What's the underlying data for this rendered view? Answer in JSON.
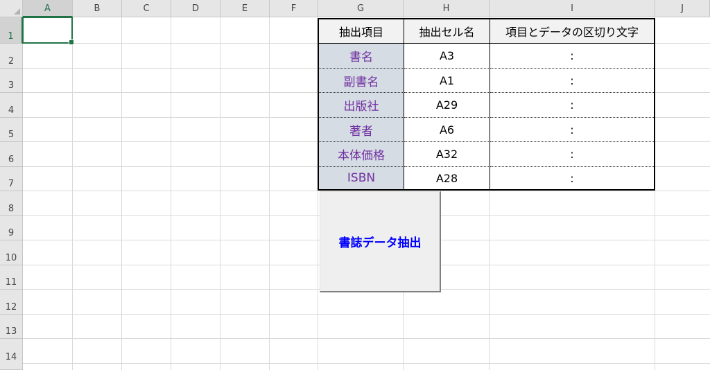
{
  "sheet": {
    "columns": [
      "A",
      "B",
      "C",
      "D",
      "E",
      "F",
      "G",
      "H",
      "I",
      "J"
    ],
    "rows": [
      "1",
      "2",
      "3",
      "4",
      "5",
      "6",
      "7",
      "8",
      "9",
      "10",
      "11",
      "12",
      "13",
      "14"
    ],
    "selected_cell": "A1"
  },
  "table": {
    "headers": [
      "抽出項目",
      "抽出セル名",
      "項目とデータの区切り文字"
    ],
    "rows": [
      {
        "item": "書名",
        "cell": "A3",
        "sep": ":"
      },
      {
        "item": "副書名",
        "cell": "A1",
        "sep": ":"
      },
      {
        "item": "出版社",
        "cell": "A29",
        "sep": ":"
      },
      {
        "item": "著者",
        "cell": "A6",
        "sep": ":"
      },
      {
        "item": "本体価格",
        "cell": "A32",
        "sep": ":"
      },
      {
        "item": "ISBN",
        "cell": "A28",
        "sep": ":"
      }
    ]
  },
  "button": {
    "label": "書誌データ抽出"
  },
  "colors": {
    "accent": "#217346",
    "item_fill": "#d6dce4",
    "item_text": "#7030a0",
    "button_text": "#0000ff"
  }
}
